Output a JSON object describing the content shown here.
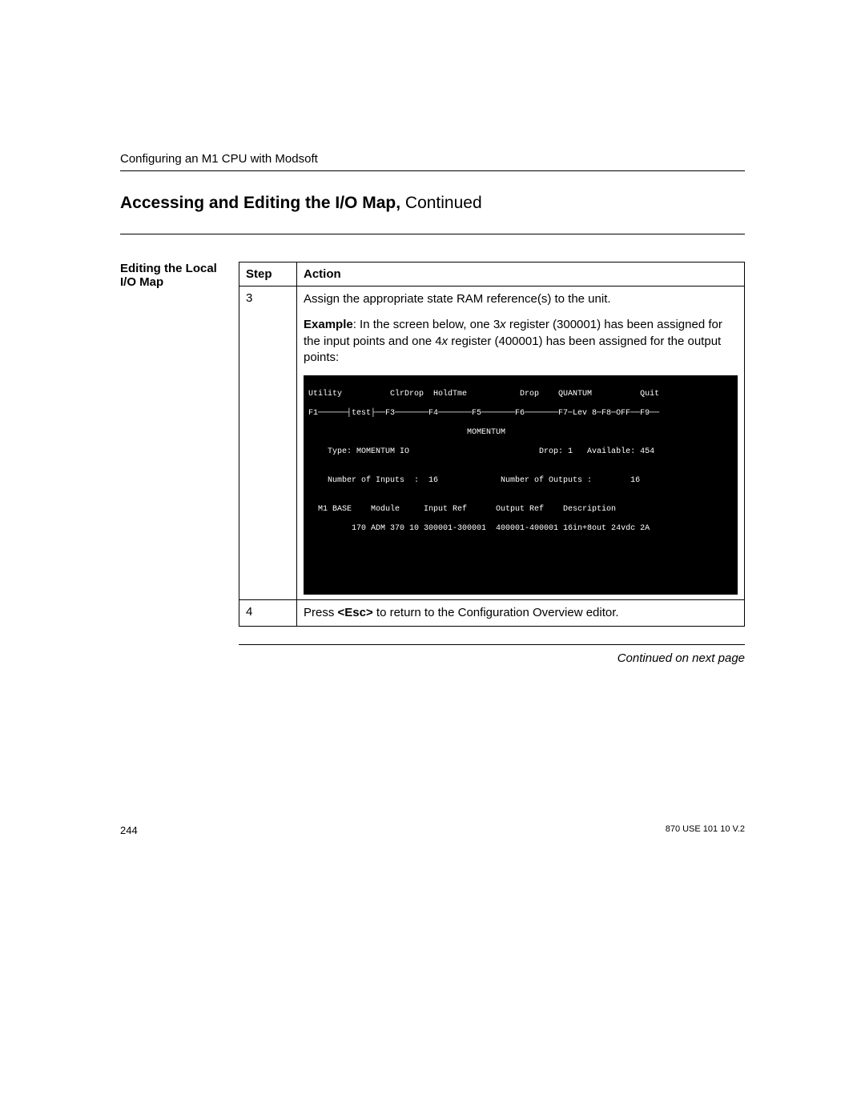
{
  "header": {
    "running": "Configuring an M1 CPU with Modsoft"
  },
  "title": {
    "main": "Accessing and Editing the I/O Map,",
    "cont": " Continued"
  },
  "side_label": "Editing the Local I/O Map",
  "table": {
    "head_step": "Step",
    "head_action": "Action",
    "row3": {
      "num": "3",
      "p1": "Assign the appropriate state RAM reference(s) to the unit.",
      "p2a": "Example",
      "p2b": ": In the screen below, one 3",
      "p2c": "x",
      "p2d": " register (300001) has been assigned for the input points and one 4",
      "p2e": "x",
      "p2f": " register (400001) has been assigned for the output points:"
    },
    "row4": {
      "num": "4",
      "p1a": "Press ",
      "p1b": "<Esc>",
      "p1c": " to return to the Configuration Overview editor."
    }
  },
  "terminal": {
    "l1": "Utility          ClrDrop  HoldTme           Drop    QUANTUM          Quit",
    "l2": "F1──────┤test├──F3───────F4───────F5───────F6───────F7─Lev 8─F8─OFF──F9──",
    "l3": "                                 MOMENTUM",
    "l4": "    Type: MOMENTUM IO                           Drop: 1   Available: 454",
    "l5": "",
    "l6": "    Number of Inputs  :  16             Number of Outputs :        16",
    "l7": "",
    "l8": "  M1 BASE    Module     Input Ref      Output Ref    Description",
    "l9": "         170 ADM 370 10 300001-300001  400001-400001 16in+8out 24vdc 2A"
  },
  "cont_next": "Continued on next page",
  "footer": {
    "pagenum": "244",
    "docid": "870 USE 101 10 V.2"
  }
}
